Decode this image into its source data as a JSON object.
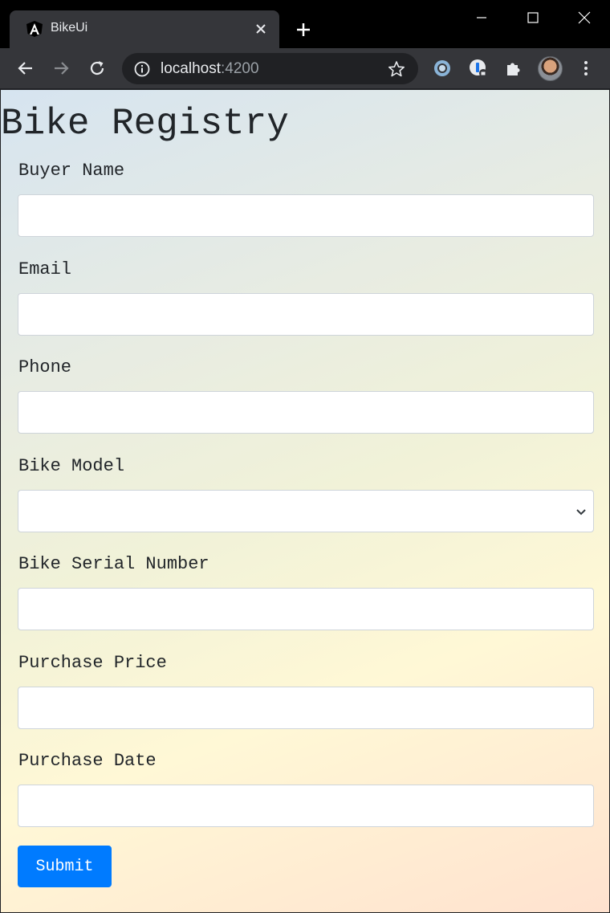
{
  "browser": {
    "tab_title": "BikeUi",
    "tab_favicon": "angular-logo-icon",
    "url_host": "localhost",
    "url_port": ":4200"
  },
  "page": {
    "title": "Bike Registry",
    "fields": [
      {
        "label": "Buyer Name",
        "type": "text",
        "value": ""
      },
      {
        "label": "Email",
        "type": "text",
        "value": ""
      },
      {
        "label": "Phone",
        "type": "text",
        "value": ""
      },
      {
        "label": "Bike Model",
        "type": "select",
        "value": ""
      },
      {
        "label": "Bike Serial Number",
        "type": "text",
        "value": ""
      },
      {
        "label": "Purchase Price",
        "type": "text",
        "value": ""
      },
      {
        "label": "Purchase Date",
        "type": "text",
        "value": ""
      }
    ],
    "submit_label": "Submit"
  },
  "colors": {
    "primary_button": "#007bff",
    "chrome_dark": "#35363a"
  }
}
